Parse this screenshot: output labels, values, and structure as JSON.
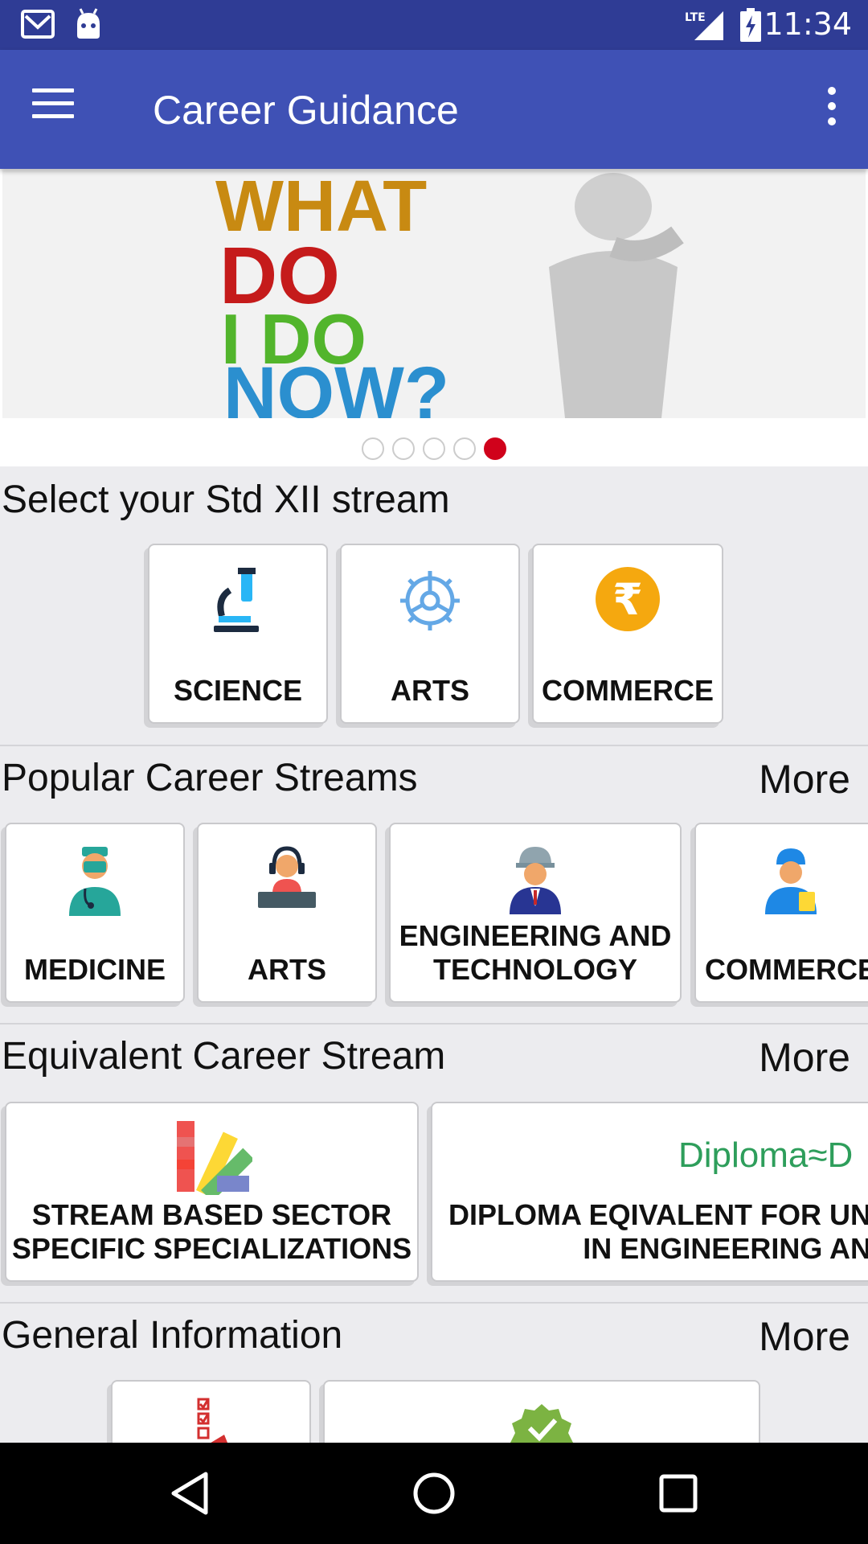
{
  "status_bar": {
    "time": "11:34",
    "network": "LTE",
    "icons": [
      "gmail-icon",
      "android-icon",
      "lte-signal-icon",
      "battery-charging-icon"
    ]
  },
  "app_bar": {
    "title": "Career Guidance",
    "menu_icon": "hamburger-menu-icon",
    "overflow_icon": "overflow-menu-icon"
  },
  "banner": {
    "image_text": "WHAT DO I DO NOW?",
    "slides": 5,
    "active_slide": 5
  },
  "stream_section": {
    "title": "Select your Std XII stream",
    "cards": [
      {
        "label": "SCIENCE",
        "icon": "microscope-icon"
      },
      {
        "label": "ARTS",
        "icon": "gear-icon"
      },
      {
        "label": "COMMERCE",
        "icon": "rupee-icon"
      }
    ]
  },
  "popular_section": {
    "title": "Popular Career Streams",
    "more": "More",
    "cards": [
      {
        "label": "MEDICINE",
        "icon": "doctor-icon"
      },
      {
        "label": "ARTS",
        "icon": "dj-icon"
      },
      {
        "label": "ENGINEERING AND\nTECHNOLOGY",
        "icon": "engineer-icon"
      },
      {
        "label": "COMMERCE",
        "icon": "worker-icon"
      }
    ]
  },
  "equivalent_section": {
    "title": "Equivalent Career Stream",
    "more": "More",
    "cards": [
      {
        "label": "STREAM BASED SECTOR\nSPECIFIC SPECIALIZATIONS",
        "icon": "color-swatch-icon"
      },
      {
        "label": "DIPLOMA EQIVALENT FOR UND\nIN ENGINEERING AND",
        "icon_text": "Diploma≈D"
      }
    ]
  },
  "general_section": {
    "title": "General Information",
    "more": "More",
    "cards": [
      {
        "icon": "checklist-icon"
      },
      {
        "icon": "verified-badge-icon"
      }
    ]
  },
  "nav_bar": {
    "icons": [
      "back-icon",
      "home-icon",
      "recents-icon"
    ]
  },
  "colors": {
    "status_bar": "#2f3c95",
    "app_bar": "#3f51b5",
    "active_dot": "#d0021b",
    "background": "#ececef"
  }
}
